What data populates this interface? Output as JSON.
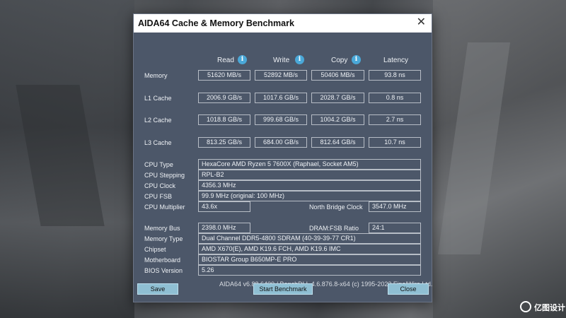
{
  "window": {
    "title": "AIDA64 Cache & Memory Benchmark",
    "close_glyph": "✕"
  },
  "columns": {
    "read": "Read",
    "write": "Write",
    "copy": "Copy",
    "latency": "Latency",
    "info_glyph": "i"
  },
  "benchmarks": [
    {
      "label": "Memory",
      "read": "51620 MB/s",
      "write": "52892 MB/s",
      "copy": "50406 MB/s",
      "latency": "93.8 ns"
    },
    {
      "label": "L1 Cache",
      "read": "2006.9 GB/s",
      "write": "1017.6 GB/s",
      "copy": "2028.7 GB/s",
      "latency": "0.8 ns"
    },
    {
      "label": "L2 Cache",
      "read": "1018.8 GB/s",
      "write": "999.68 GB/s",
      "copy": "1004.2 GB/s",
      "latency": "2.7 ns"
    },
    {
      "label": "L3 Cache",
      "read": "813.25 GB/s",
      "write": "684.00 GB/s",
      "copy": "812.64 GB/s",
      "latency": "10.7 ns"
    }
  ],
  "cpu": {
    "type_label": "CPU Type",
    "type_value": "HexaCore AMD Ryzen 5 7600X  (Raphael, Socket AM5)",
    "stepping_label": "CPU Stepping",
    "stepping_value": "RPL-B2",
    "clock_label": "CPU Clock",
    "clock_value": "4356.3 MHz",
    "fsb_label": "CPU FSB",
    "fsb_value": "99.9 MHz  (original: 100 MHz)",
    "multiplier_label": "CPU Multiplier",
    "multiplier_value": "43.6x",
    "nb_clock_label": "North Bridge Clock",
    "nb_clock_value": "3547.0 MHz"
  },
  "system": {
    "bus_label": "Memory Bus",
    "bus_value": "2398.0 MHz",
    "ratio_label": "DRAM:FSB Ratio",
    "ratio_value": "24:1",
    "memtype_label": "Memory Type",
    "memtype_value": "Dual Channel DDR5-4800 SDRAM  (40-39-39-77 CR1)",
    "chipset_label": "Chipset",
    "chipset_value": "AMD X670(E), AMD K19.6 FCH, AMD K19.6 IMC",
    "mobo_label": "Motherboard",
    "mobo_value": "BIOSTAR Group B650MP-E PRO",
    "bios_label": "BIOS Version",
    "bios_value": "5.26"
  },
  "footer": "AIDA64 v6.88.6400 / BenchDLL 4.6.876.8-x64  (c) 1995-2023 FinalWire Ltd.",
  "buttons": {
    "save": "Save",
    "start": "Start Benchmark",
    "close": "Close"
  },
  "watermark": "亿图设计"
}
